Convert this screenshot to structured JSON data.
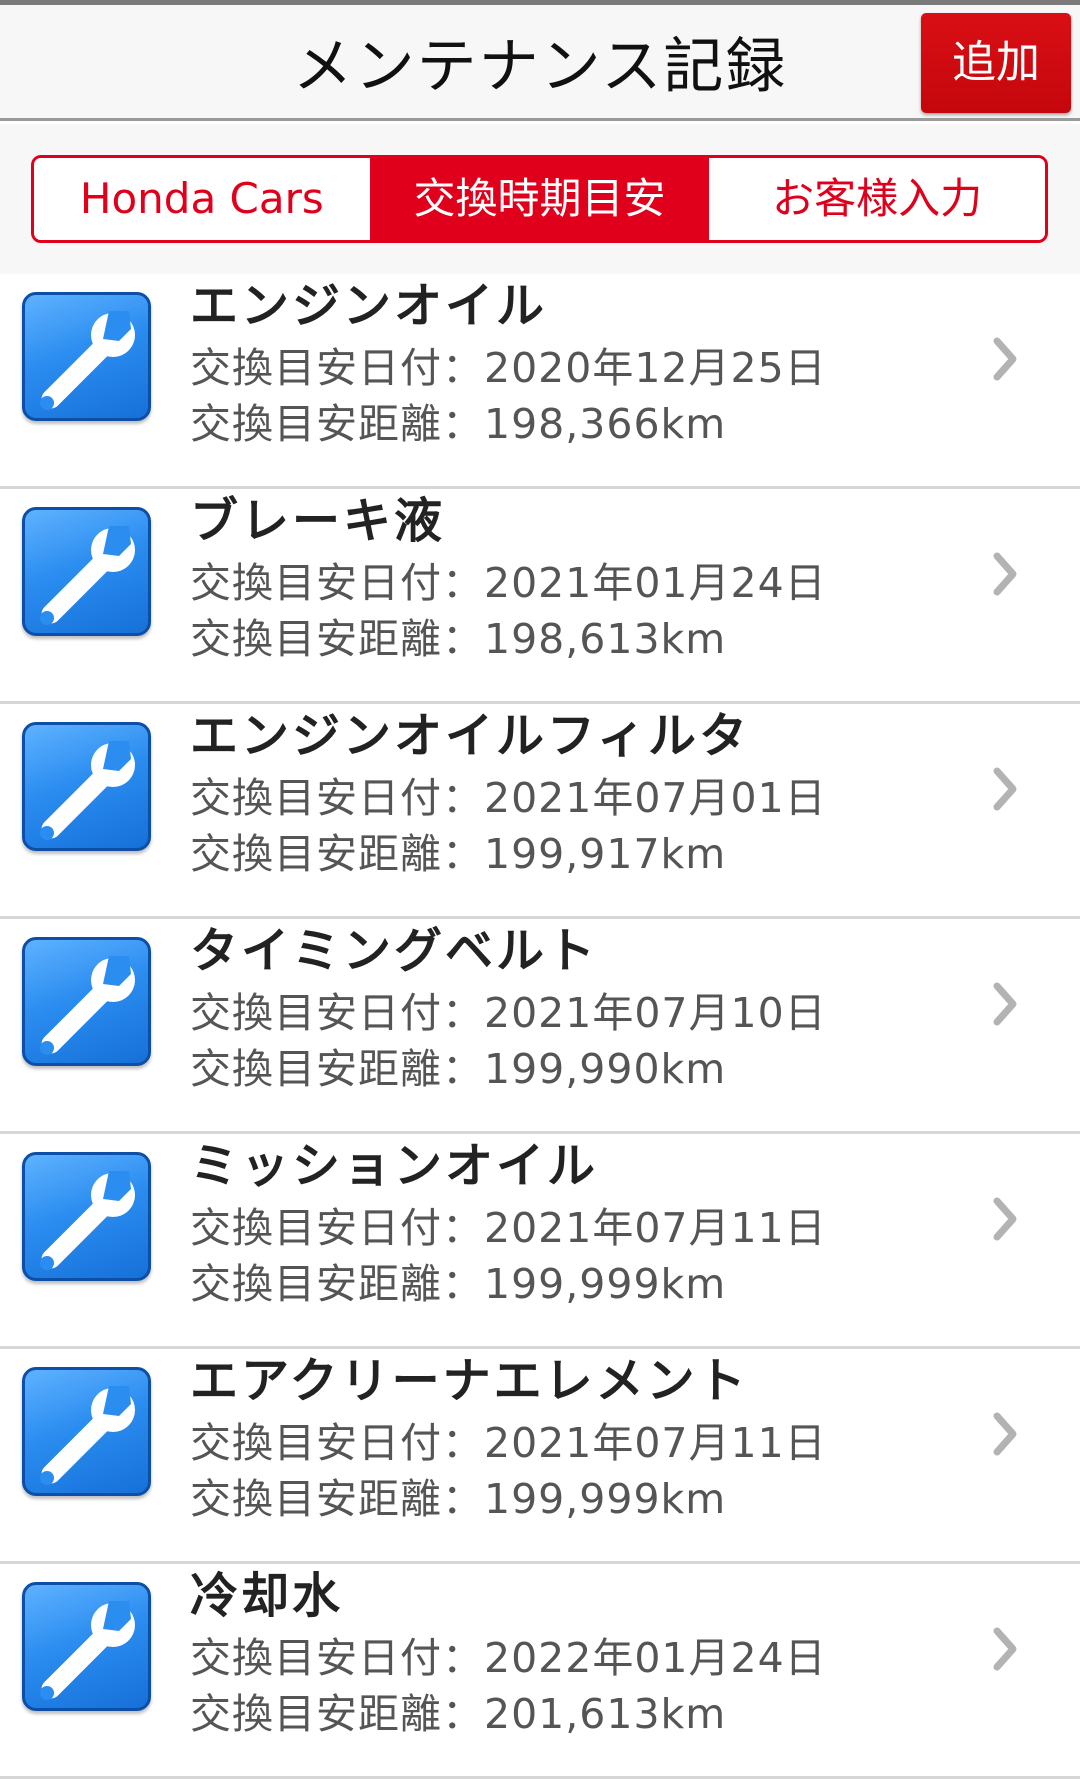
{
  "header": {
    "title": "メンテナンス記録",
    "add_label": "追加"
  },
  "tabs": [
    {
      "label": "Honda Cars",
      "active": false
    },
    {
      "label": "交換時期目安",
      "active": true
    },
    {
      "label": "お客様入力",
      "active": false
    }
  ],
  "list": {
    "icon": "wrench-icon",
    "items": [
      {
        "name": "エンジンオイル",
        "date": "交換目安日付：2020年12月25日",
        "distance": "交換目安距離：198,366km"
      },
      {
        "name": "ブレーキ液",
        "date": "交換目安日付：2021年01月24日",
        "distance": "交換目安距離：198,613km"
      },
      {
        "name": "エンジンオイルフィルタ",
        "date": "交換目安日付：2021年07月01日",
        "distance": "交換目安距離：199,917km"
      },
      {
        "name": "タイミングベルト",
        "date": "交換目安日付：2021年07月10日",
        "distance": "交換目安距離：199,990km"
      },
      {
        "name": "ミッションオイル",
        "date": "交換目安日付：2021年07月11日",
        "distance": "交換目安距離：199,999km"
      },
      {
        "name": "エアクリーナエレメント",
        "date": "交換目安日付：2021年07月11日",
        "distance": "交換目安距離：199,999km"
      },
      {
        "name": "冷却水",
        "date": "交換目安日付：2022年01月24日",
        "distance": "交換目安距離：201,613km"
      }
    ]
  },
  "colors": {
    "accent": "#e0001c",
    "icon_blue": "#2b8df0"
  }
}
